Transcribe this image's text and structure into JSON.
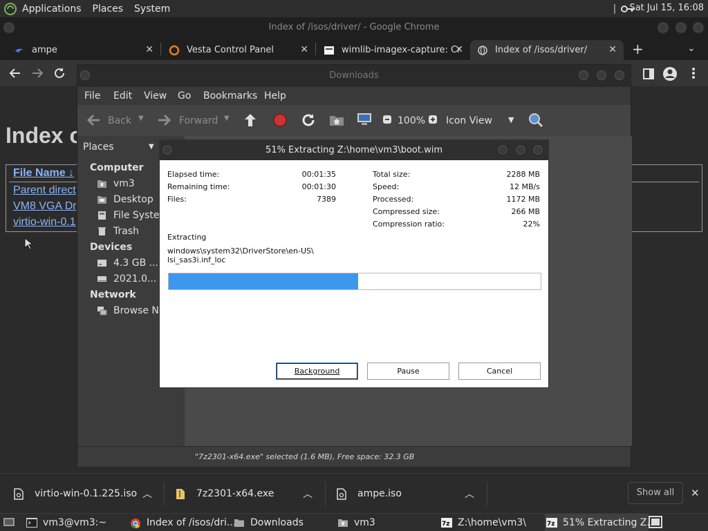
{
  "top_panel": {
    "menus": [
      "Applications",
      "Places",
      "System"
    ],
    "clock": "Sat Jul 15, 16:08"
  },
  "browser": {
    "window_title": "Index of /isos/driver/ - Google Chrome",
    "tabs": [
      {
        "label": "ampe",
        "icon": "proxmox-icon"
      },
      {
        "label": "Vesta Control Panel",
        "icon": "vesta-icon"
      },
      {
        "label": "wimlib-imagex-capture: Cr",
        "icon": "page-icon"
      },
      {
        "label": "Index of /isos/driver/",
        "icon": "globe-icon"
      }
    ],
    "page": {
      "heading": "Index c",
      "column_header": "File Name",
      "column_header_suffix": "↓",
      "links": [
        "Parent direct",
        "VM8 VGA Dr",
        "virtio-win-0.1"
      ]
    }
  },
  "file_manager": {
    "title": "Downloads",
    "menu": [
      "File",
      "Edit",
      "View",
      "Go",
      "Bookmarks",
      "Help"
    ],
    "toolbar": {
      "back": "Back",
      "forward": "Forward",
      "zoom": "100%",
      "view_mode": "Icon View"
    },
    "sidebar": {
      "dropdown": "Places",
      "sections": [
        {
          "heading": "Computer",
          "items": [
            "vm3",
            "Desktop",
            "File System",
            "Trash"
          ]
        },
        {
          "heading": "Devices",
          "items": [
            "4.3 GB ...",
            "2021.0..."
          ]
        },
        {
          "heading": "Network",
          "items": [
            "Browse Net"
          ]
        }
      ]
    },
    "status": "\"7z2301-x64.exe\" selected (1.6 MB), Free space: 32.3 GB"
  },
  "dialog": {
    "title": "51% Extracting Z:\\home\\vm3\\boot.wim",
    "left_stats": [
      {
        "label": "Elapsed time:",
        "value": "00:01:35"
      },
      {
        "label": "Remaining time:",
        "value": "00:01:30"
      },
      {
        "label": "Files:",
        "value": "7389"
      }
    ],
    "right_stats": [
      {
        "label": "Total size:",
        "value": "2288 MB"
      },
      {
        "label": "Speed:",
        "value": "12 MB/s"
      },
      {
        "label": "Processed:",
        "value": "1172 MB"
      },
      {
        "label": "Compressed size:",
        "value": "266 MB"
      },
      {
        "label": "Compression ratio:",
        "value": "22%"
      }
    ],
    "operation": "Extracting",
    "current_path_line1": "windows\\system32\\DriverStore\\en-US\\",
    "current_path_line2": "lsi_sas3i.inf_loc",
    "progress_percent": 51,
    "buttons": {
      "background": "Background",
      "pause": "Pause",
      "cancel": "Cancel"
    }
  },
  "download_shelf": {
    "items": [
      "virtio-win-0.1.225.iso",
      "7z2301-x64.exe",
      "ampe.iso"
    ],
    "show_all": "Show all"
  },
  "taskbar": {
    "items": [
      {
        "label": "vm3@vm3:~",
        "icon": "terminal-icon"
      },
      {
        "label": "Index of /isos/dri...",
        "icon": "chrome-icon"
      },
      {
        "label": "Downloads",
        "icon": "folder-icon"
      },
      {
        "label": "vm3",
        "icon": "home-folder-icon"
      },
      {
        "label": "Z:\\home\\vm3\\",
        "icon": "7zip-icon"
      },
      {
        "label": "51% Extracting Z...",
        "icon": "7zip-icon"
      }
    ]
  },
  "colors": {
    "progress_fill": "#3d97ec",
    "link": "#8ab4f8",
    "stop_button": "#cc3333"
  }
}
